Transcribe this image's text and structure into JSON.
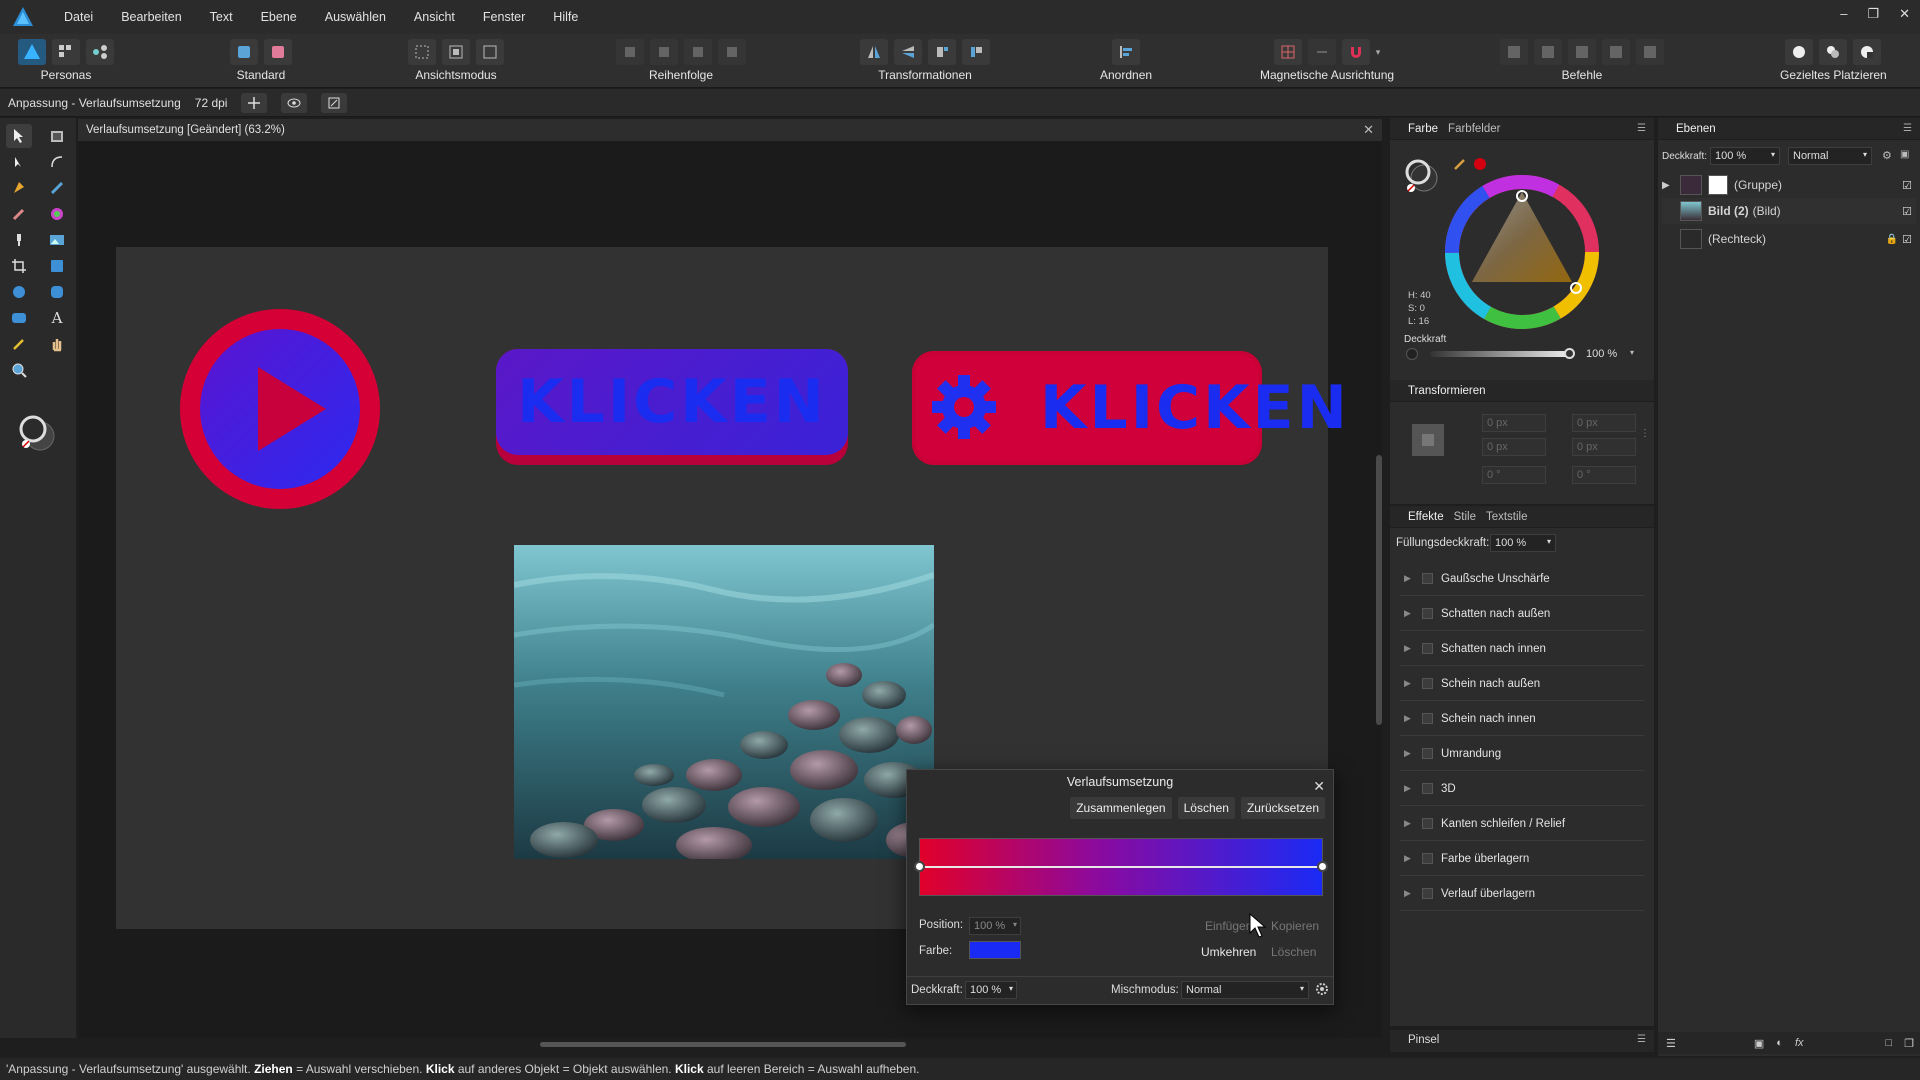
{
  "menu": [
    "Datei",
    "Bearbeiten",
    "Text",
    "Ebene",
    "Auswählen",
    "Ansicht",
    "Fenster",
    "Hilfe"
  ],
  "toolbar": {
    "personas": "Personas",
    "standard": "Standard",
    "ansichtsmodus": "Ansichtsmodus",
    "reihenfolge": "Reihenfolge",
    "transformationen": "Transformationen",
    "anordnen": "Anordnen",
    "magnetische": "Magnetische Ausrichtung",
    "befehle": "Befehle",
    "gezieltes": "Gezieltes Platzieren"
  },
  "context": {
    "title": "Anpassung - Verlaufsumsetzung",
    "dpi": "72 dpi"
  },
  "document": {
    "tab_title": "Verlaufsumsetzung [Geändert] (63.2%)"
  },
  "canvas": {
    "button1_text": "KLICKEN",
    "button2_text": "KLICKEN"
  },
  "gradient_dialog": {
    "title": "Verlaufsumsetzung",
    "merge": "Zusammenlegen",
    "delete": "Löschen",
    "reset": "Zurücksetzen",
    "position_label": "Position:",
    "position_value": "100 %",
    "insert": "Einfügen",
    "copy": "Kopieren",
    "color_label": "Farbe:",
    "invert": "Umkehren",
    "delete2": "Löschen",
    "opacity_label": "Deckkraft:",
    "opacity_value": "100 %",
    "blend_label": "Mischmodus:",
    "blend_value": "Normal",
    "selected_color": "#1a2af5"
  },
  "color_panel": {
    "tab_farbe": "Farbe",
    "tab_farbfelder": "Farbfelder",
    "h": "H: 40",
    "s": "S: 0",
    "l": "L: 16",
    "opacity_label": "Deckkraft",
    "opacity_value": "100 %"
  },
  "transform_panel": {
    "title": "Transformieren",
    "x": "0 px",
    "y": "0 px",
    "w": "0 px",
    "h": "0 px",
    "r": "0 °",
    "s": "0 °"
  },
  "effects_panel": {
    "tab_effekte": "Effekte",
    "tab_stile": "Stile",
    "tab_textstile": "Textstile",
    "fill_opacity_label": "Füllungsdeckkraft:",
    "fill_opacity_value": "100 %",
    "effects": [
      "Gaußsche Unschärfe",
      "Schatten nach außen",
      "Schatten nach innen",
      "Schein nach außen",
      "Schein nach innen",
      "Umrandung",
      "3D",
      "Kanten schleifen / Relief",
      "Farbe überlagern",
      "Verlauf überlagern"
    ]
  },
  "brush_panel": {
    "title": "Pinsel"
  },
  "layers_panel": {
    "title": "Ebenen",
    "opacity_label": "Deckkraft:",
    "opacity_value": "100 %",
    "blend": "Normal",
    "layers": [
      {
        "name": "(Gruppe)",
        "bold": ""
      },
      {
        "name": "(Bild)",
        "bold": "Bild (2)"
      },
      {
        "name": "(Rechteck)",
        "bold": ""
      }
    ]
  },
  "status": {
    "part1": "'Anpassung - Verlaufsumsetzung' ausgewählt. ",
    "b1": "Ziehen",
    "part2": " = Auswahl verschieben. ",
    "b2": "Klick",
    "part3": " auf anderes Objekt = Objekt auswählen. ",
    "b3": "Klick",
    "part4": " auf leeren Bereich = Auswahl aufheben."
  },
  "colors": {
    "accent_red": "#d4002e",
    "accent_blue": "#1a2af5",
    "purple": "#5a1ac8"
  }
}
